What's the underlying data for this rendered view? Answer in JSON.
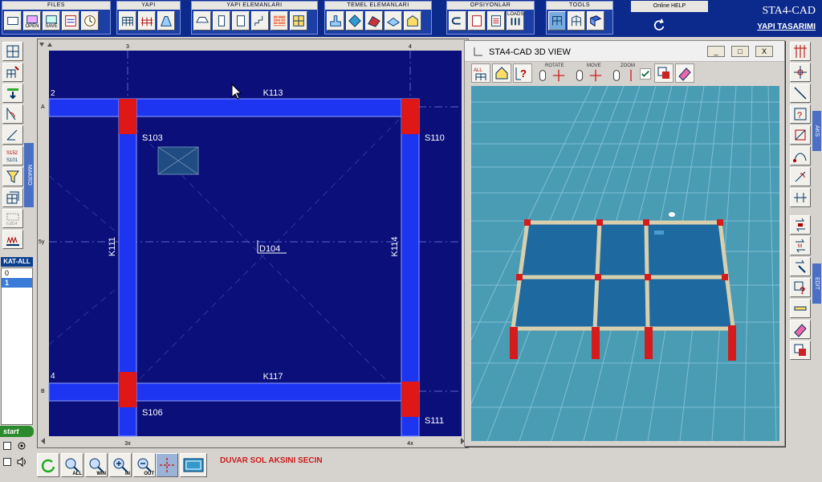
{
  "toolbar": {
    "groups": [
      {
        "title": "FILES",
        "buttons": [
          "NEW",
          "OPEN",
          "SAVE",
          "PROPS",
          "CLOCK"
        ],
        "captions": [
          "",
          "OPEN",
          "SAVE",
          "",
          ""
        ]
      },
      {
        "title": "YAPI",
        "buttons": [
          "FRAME",
          "COLUMN",
          "SLAB"
        ]
      },
      {
        "title": "YAPI ELEMANLARI",
        "buttons": [
          "BEAM",
          "COLUMN",
          "WALL",
          "STAIR",
          "BRICK",
          "GRID"
        ]
      },
      {
        "title": "TEMEL ELEMANLARI",
        "buttons": [
          "FOOT",
          "PILE",
          "TIE",
          "RAFT",
          "PIER"
        ]
      },
      {
        "title": "OPSIYONLAR",
        "buttons": [
          "UNDO",
          "NOTE",
          "LIST",
          "LOADS"
        ],
        "captions": [
          "",
          "",
          "",
          "LOADS"
        ]
      },
      {
        "title": "TOOLS",
        "buttons": [
          "T1",
          "T2",
          "T3"
        ]
      }
    ],
    "help_label": "Online HELP",
    "brand_title": "STA4-CAD",
    "brand_subtitle": "YAPI TASARIMI"
  },
  "left_panel": {
    "makro_label": "MAKRO",
    "kat_all_label": "KAT-ALL",
    "floors": [
      "0",
      "1"
    ],
    "start_label": "start"
  },
  "cad": {
    "axes_top": [
      "3",
      "4"
    ],
    "axes_bottom": [
      "3x",
      "4x"
    ],
    "axes_left": [
      "A",
      "5y",
      "B"
    ],
    "corner_marks": [
      "2",
      "4"
    ],
    "beams": [
      "K113",
      "K117",
      "K111",
      "K114"
    ],
    "columns": [
      "S103",
      "S110",
      "S106",
      "S111"
    ],
    "slab": "D104"
  },
  "view3d": {
    "title": "STA4-CAD  3D VIEW",
    "tool_labels": [
      "ROTATE",
      "MOVE",
      "ZOOM"
    ],
    "window_buttons": [
      "_",
      "□",
      "X"
    ],
    "colors": {
      "background": "#4a9bb4",
      "slab": "#1e6aa0",
      "beam": "#d8cfae",
      "column": "#d41c1c"
    }
  },
  "right_panel": {
    "tab_aks": "AKS",
    "tab_edit": "EDIT"
  },
  "bottom": {
    "buttons": [
      "REFRESH",
      "ZOOM-ALL",
      "ZOOM-WIN",
      "ZOOM-IN",
      "ZOOM-OUT",
      "CROSSHAIR",
      "VIEWPORT"
    ],
    "captions": [
      "",
      "ALL",
      "WIN",
      "IN",
      "OUT",
      "",
      ""
    ],
    "status_message": "DUVAR SOL AKSINI SECIN"
  },
  "colors": {
    "cad_background": "#0a0f7a",
    "beam_fill": "#1d35f0",
    "column_fill": "#e01717",
    "status_text": "#cc1a1a"
  }
}
